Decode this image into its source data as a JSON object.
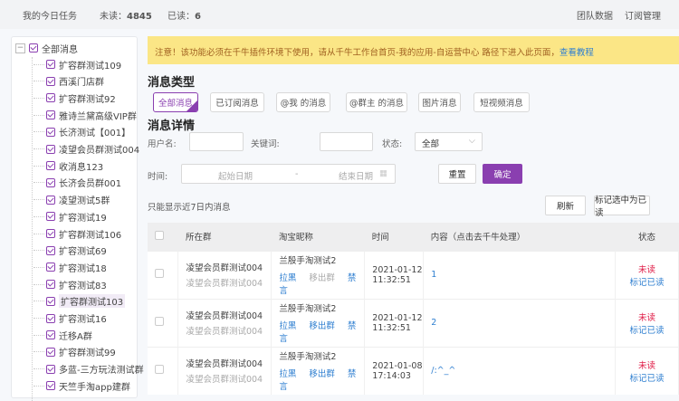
{
  "header": {
    "title": "我的今日任务",
    "unread_label": "未读：",
    "unread": "4845",
    "read_label": "已读：",
    "read": "6",
    "team_data": "团队数据",
    "subscribe_manage": "订阅管理"
  },
  "sidebar": {
    "root": "全部消息",
    "items": [
      "扩容群测试109",
      "西溪门店群",
      "扩容群测试92",
      "雅诗兰黛高级VIP群",
      "长济测试【001】",
      "凌望会员群测试004",
      "收消息123",
      "长济会员群001",
      "凌望测试5群",
      "扩容测试19",
      "扩容群测试106",
      "扩容测试69",
      "扩容测试18",
      "扩容测试83",
      "扩容群测试103",
      "扩容测试16",
      "迁移A群",
      "扩容群测试99",
      "多蓝-三方玩法测试群",
      "天竺手淘app建群"
    ],
    "selected": "扩容群测试103"
  },
  "notice": {
    "text": "注意！该功能必须在千牛插件环境下使用，请从千牛工作台首页-我的应用-自运营中心 路径下进入此页面，",
    "link": "查看教程"
  },
  "types": {
    "title": "消息类型",
    "buttons": [
      "全部消息",
      "已订阅消息",
      "@我 的消息",
      "@群主 的消息",
      "图片消息",
      "短视频消息"
    ],
    "active": "全部消息"
  },
  "filters": {
    "title": "消息详情",
    "username_label": "用户名:",
    "keyword_label": "关键词:",
    "status_label": "状态:",
    "status_value": "全部",
    "time_label": "时间:",
    "start_placeholder": "起始日期",
    "sep": "-",
    "end_placeholder": "结束日期",
    "reset": "重置",
    "confirm": "确定",
    "hint": "只能显示近7日内消息",
    "refresh": "刷新",
    "mark_selected": "标记选中为已读"
  },
  "table": {
    "headers": [
      "所在群",
      "淘宝昵称",
      "时间",
      "内容（点击去千牛处理）",
      "状态"
    ],
    "rows": [
      {
        "group": "凌望会员群测试004",
        "group_sub": "凌望会员群测试004",
        "nick": "兰殷手淘测试2",
        "a1": "拉黑",
        "a2": "移出群",
        "a3": "禁言",
        "a2_disabled": true,
        "date": "2021-01-12",
        "time": "11:32:51",
        "content": "1",
        "status": "未读",
        "mark": "标记已读"
      },
      {
        "group": "凌望会员群测试004",
        "group_sub": "凌望会员群测试004",
        "nick": "兰殷手淘测试2",
        "a1": "拉黑",
        "a2": "移出群",
        "a3": "禁言",
        "a2_disabled": false,
        "date": "2021-01-12",
        "time": "11:32:51",
        "content": "2",
        "status": "未读",
        "mark": "标记已读"
      },
      {
        "group": "凌望会员群测试004",
        "group_sub": "凌望会员群测试004",
        "nick": "兰殷手淘测试2",
        "a1": "拉黑",
        "a2": "移出群",
        "a3": "禁言",
        "a2_disabled": false,
        "date": "2021-01-08",
        "time": "17:14:03",
        "content": "/:^_^",
        "status": "未读",
        "mark": "标记已读"
      }
    ]
  }
}
